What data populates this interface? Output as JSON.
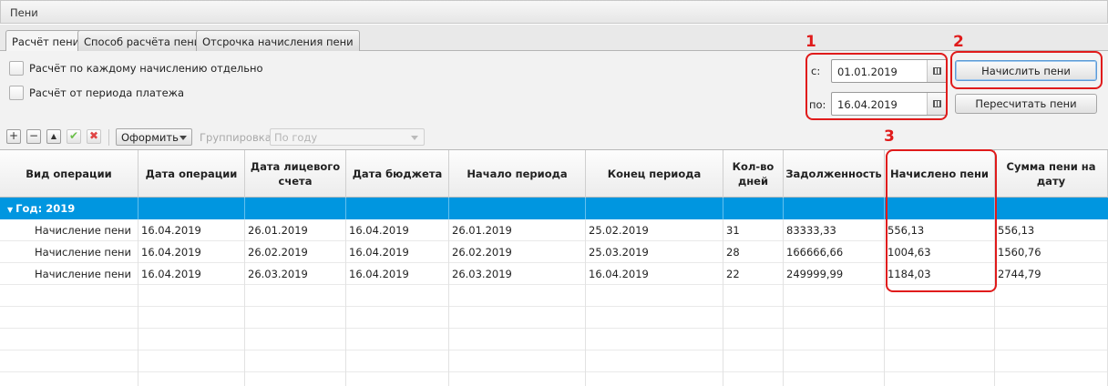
{
  "window": {
    "title": "Пени"
  },
  "tabs": [
    {
      "label": "Расчёт пени",
      "active": true
    },
    {
      "label": "Способ расчёта пени",
      "active": false
    },
    {
      "label": "Отсрочка начисления пени",
      "active": false
    }
  ],
  "options": [
    {
      "label": "Расчёт по каждому начислению отдельно",
      "checked": false
    },
    {
      "label": "Расчёт от периода платежа",
      "checked": false
    }
  ],
  "period": {
    "from_label": "с:",
    "from_value": "01.01.2019",
    "to_label": "по:",
    "to_value": "16.04.2019"
  },
  "actions": {
    "calculate": "Начислить пени",
    "recalculate": "Пересчитать пени"
  },
  "annotations": {
    "color": "#e01b1b",
    "labels": [
      "1",
      "2",
      "3"
    ]
  },
  "toolbar": {
    "icons": [
      "add-icon",
      "remove-icon",
      "up-icon",
      "confirm-icon",
      "delete-icon"
    ],
    "format_label": "Оформить",
    "grouping_label": "Группировка",
    "grouping_value": "По году"
  },
  "table": {
    "columns": [
      "Вид операции",
      "Дата операции",
      "Дата лицевого счета",
      "Дата бюджета",
      "Начало периода",
      "Конец периода",
      "Кол-во дней",
      "Задолженность",
      "Начислено пени",
      "Сумма пени на дату"
    ],
    "group_label": "Год: 2019",
    "group_color": "#0096e0",
    "rows": [
      [
        "Начисление пени",
        "16.04.2019",
        "26.01.2019",
        "16.04.2019",
        "26.01.2019",
        "25.02.2019",
        "31",
        "83333,33",
        "556,13",
        "556,13"
      ],
      [
        "Начисление пени",
        "16.04.2019",
        "26.02.2019",
        "16.04.2019",
        "26.02.2019",
        "25.03.2019",
        "28",
        "166666,66",
        "1004,63",
        "1560,76"
      ],
      [
        "Начисление пени",
        "16.04.2019",
        "26.03.2019",
        "16.04.2019",
        "26.03.2019",
        "16.04.2019",
        "22",
        "249999,99",
        "1184,03",
        "2744,79"
      ]
    ]
  }
}
